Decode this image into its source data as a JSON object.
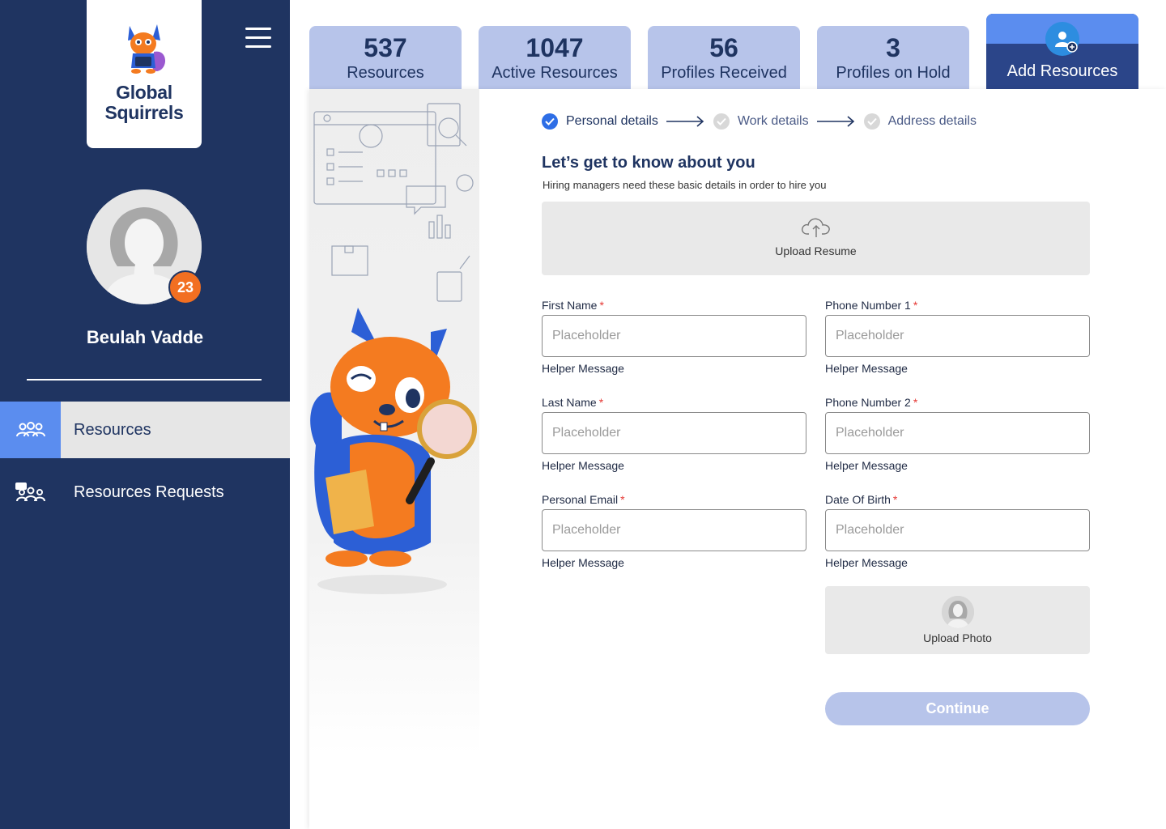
{
  "brand": {
    "name_line1": "Global",
    "name_line2": "Squirrels"
  },
  "user": {
    "name": "Beulah Vadde",
    "notification_count": "23"
  },
  "sidebar": {
    "items": [
      {
        "label": "Resources",
        "active": true
      },
      {
        "label": "Resources Requests",
        "active": false
      }
    ]
  },
  "stats": [
    {
      "value": "537",
      "label": "Resources"
    },
    {
      "value": "1047",
      "label": "Active Resources"
    },
    {
      "value": "56",
      "label": "Profiles Received"
    },
    {
      "value": "3",
      "label": "Profiles on Hold"
    }
  ],
  "add_resources": {
    "label": "Add Resources"
  },
  "steps": [
    {
      "label": "Personal details",
      "status": "done"
    },
    {
      "label": "Work details",
      "status": "pending"
    },
    {
      "label": "Address details",
      "status": "pending"
    }
  ],
  "form": {
    "heading": "Let’s get to know about you",
    "subheading": "Hiring managers need these basic details in order to hire you",
    "upload_resume": "Upload Resume",
    "upload_photo": "Upload Photo",
    "continue": "Continue",
    "fields": {
      "first_name": {
        "label": "First Name",
        "placeholder": "Placeholder",
        "helper": "Helper Message"
      },
      "last_name": {
        "label": "Last Name",
        "placeholder": "Placeholder",
        "helper": "Helper Message"
      },
      "personal_email": {
        "label": "Personal Email",
        "placeholder": "Placeholder",
        "helper": "Helper Message"
      },
      "phone_1": {
        "label": "Phone Number 1",
        "placeholder": "Placeholder",
        "helper": "Helper Message"
      },
      "phone_2": {
        "label": "Phone Number 2",
        "placeholder": "Placeholder",
        "helper": "Helper Message"
      },
      "dob": {
        "label": "Date Of Birth",
        "placeholder": "Placeholder",
        "helper": "Helper Message"
      }
    },
    "required_mark": "*"
  },
  "colors": {
    "sidebar_bg": "#1f3461",
    "accent_blue": "#5b8def",
    "stat_card": "#b7c4ea",
    "badge_orange": "#f26f21",
    "step_done": "#2e6ee6",
    "required": "#e53935"
  },
  "icons": {
    "logo": "squirrel-mascot-icon",
    "menu": "hamburger-menu-icon",
    "resources": "users-group-icon",
    "requests": "users-request-icon",
    "add": "add-user-icon",
    "upload": "cloud-upload-icon",
    "photo": "user-placeholder-icon"
  }
}
